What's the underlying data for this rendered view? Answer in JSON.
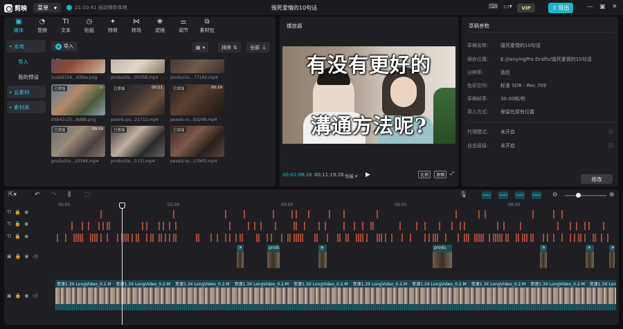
{
  "titlebar": {
    "app_name": "剪映",
    "menu_label": "菜单",
    "autosave": "21:10:41 自动保存本地",
    "doc_title": "毁死爱情的10句话",
    "vip_label": "VIP",
    "export_label": "导出"
  },
  "media_tabs": [
    {
      "label": "媒体",
      "icon": "media-icon",
      "active": true
    },
    {
      "label": "音频",
      "icon": "audio-icon"
    },
    {
      "label": "文本",
      "icon": "text-icon"
    },
    {
      "label": "贴纸",
      "icon": "sticker-icon"
    },
    {
      "label": "特效",
      "icon": "effects-icon"
    },
    {
      "label": "转场",
      "icon": "transition-icon"
    },
    {
      "label": "滤镜",
      "icon": "filter-icon"
    },
    {
      "label": "调节",
      "icon": "adjust-icon"
    },
    {
      "label": "素材包",
      "icon": "package-icon"
    }
  ],
  "sidebar": {
    "local": "本地",
    "import": "导入",
    "presets": "我的预设",
    "cloud": "云素材",
    "library": "素材库"
  },
  "media_toolbar": {
    "import_label": "导入",
    "sort_label": "排序",
    "filter_label": "全部",
    "all_label": "全部"
  },
  "media_items": [
    {
      "name": "1cd26358...43fee.png",
      "added": false,
      "duration": ""
    },
    {
      "name": "productio...00358.mp4",
      "added": false,
      "duration": ""
    },
    {
      "name": "productio...77169.mp4",
      "added": false,
      "duration": ""
    },
    {
      "name": "05b42c25...8d88.png",
      "added": true,
      "duration": ""
    },
    {
      "name": "pexels-po...21712.mp4",
      "added": true,
      "duration": "00:11"
    },
    {
      "name": "pexels-ro...93248.mp4",
      "added": true,
      "duration": "00:19"
    },
    {
      "name": "productio...10344.mp4",
      "added": true,
      "duration": "00:19"
    },
    {
      "name": "productio...3 (1).mp4",
      "added": true,
      "duration": ""
    },
    {
      "name": "pexels-ro...17905.mp4",
      "added": true,
      "duration": ""
    }
  ],
  "added_badge": "已添加",
  "player": {
    "title": "播放器",
    "caption_line1": "有没有更好的",
    "caption_line2": "溝通方法呢?",
    "current_time": "00:01:08:26",
    "total_time": "00:11:19:26",
    "perf_label": "性能",
    "ratio_label": "比例",
    "original_label": "原图"
  },
  "draft": {
    "title": "草稿参数",
    "rows": [
      {
        "key": "草稿名称:",
        "value": "毁死爱情的10句话"
      },
      {
        "key": "保存位置:",
        "value": "E:/JianyingPro Drafts/毁死爱情的10句话"
      },
      {
        "key": "分辨率:",
        "value": "适应"
      },
      {
        "key": "色彩空间:",
        "value": "标准 SDR - Rec.709"
      },
      {
        "key": "草稿帧率:",
        "value": "30.00帧/秒"
      },
      {
        "key": "导入方式:",
        "value": "保留在原有位置"
      },
      {
        "key": "代理模式:",
        "value": "未开启"
      },
      {
        "key": "自由层级:",
        "value": "未开启"
      }
    ],
    "modify_label": "修改"
  },
  "timeline": {
    "ruler": [
      "00:00",
      "02:00",
      "04:00",
      "06:00",
      "08:00"
    ],
    "main_clip_label": "变速1.3X  LongVideo_0.2.M",
    "broll_label": "produ"
  }
}
